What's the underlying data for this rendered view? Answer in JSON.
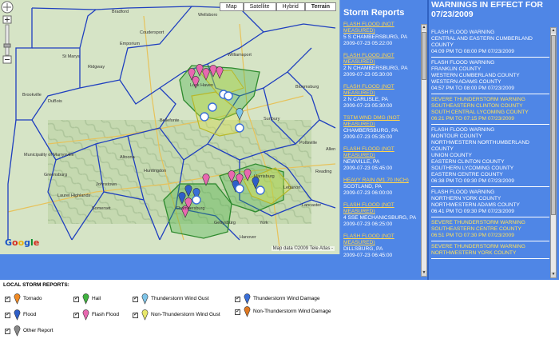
{
  "map": {
    "buttons": [
      "Map",
      "Satellite",
      "Hybrid",
      "Terrain"
    ],
    "active_button": "Terrain",
    "attribution": "Map data ©2009 Tele Atlas -",
    "logo": "Google",
    "place_labels": [
      "Bradford",
      "Wellsboro",
      "St Marys",
      "Ridgway",
      "DuBois",
      "Brookville",
      "Bellefonte",
      "Johnstown",
      "Somerset",
      "Altoona",
      "Huntingdon",
      "Chambersburg",
      "Gettysburg",
      "York",
      "Lancaster",
      "Reading",
      "Harrisburg",
      "Lebanon",
      "Sunbury",
      "Pottsville",
      "Bloomsburg",
      "Williamsport",
      "Allen",
      "Municipality of Murrysville",
      "Greensburg",
      "Laurel Highlands",
      "Hanover",
      "Coudersport",
      "Emporium",
      "Lock Haven"
    ]
  },
  "reports": {
    "title": "Storm Reports",
    "items": [
      {
        "type": "FLASH FLOOD (NOT MEASURED)",
        "location": "5 S CHAMBERSBURG, PA",
        "time": "2009-07-23 05:22:00"
      },
      {
        "type": "FLASH FLOOD (NOT MEASURED)",
        "location": "2 N CHAMBERSBURG, PA",
        "time": "2009-07-23 05:30:00"
      },
      {
        "type": "FLASH FLOOD (NOT MEASURED)",
        "location": "2 N CARLISLE, PA",
        "time": "2009-07-23 05:30:00"
      },
      {
        "type": "TSTM WND DMG (NOT MEASURED)",
        "location": "CHAMBERSBURG, PA",
        "time": "2009-07-23 05:35:00"
      },
      {
        "type": "FLASH FLOOD (NOT MEASURED)",
        "location": "NEWVILLE, PA",
        "time": "2009-07-23 05:45:00"
      },
      {
        "type": "HEAVY RAIN (M1.70 INCH)",
        "location": "SCOTLAND, PA",
        "time": "2009-07-23 06:00:00"
      },
      {
        "type": "FLASH FLOOD (NOT MEASURED)",
        "location": "4 SSE MECHANICSBURG, PA",
        "time": "2009-07-23 06:25:00"
      },
      {
        "type": "FLASH FLOOD (NOT MEASURED)",
        "location": "DILLSBURG, PA",
        "time": "2009-07-23 06:45:00"
      }
    ]
  },
  "warnings": {
    "title": "WARNINGS IN EFFECT FOR 07/23/2009",
    "items": [
      {
        "color": "white",
        "lines": [
          "FLASH FLOOD WARNING",
          "CENTRAL AND EASTERN CUMBERLAND COUNTY",
          "04:09 PM TO 08:00 PM 07/23/2009"
        ]
      },
      {
        "color": "white",
        "lines": [
          "FLASH FLOOD WARNING",
          "FRANKLIN COUNTY",
          "WESTERN CUMBERLAND COUNTY",
          "WESTERN ADAMS COUNTY",
          "04:57 PM TO 08:00 PM 07/23/2009"
        ]
      },
      {
        "color": "yellow",
        "lines": [
          "SEVERE THUNDERSTORM WARNING",
          "SOUTHEASTERN CLINTON COUNTY",
          "SOUTH CENTRAL LYCOMING COUNTY",
          "06:21 PM TO 07:15 PM 07/23/2009"
        ]
      },
      {
        "color": "white",
        "lines": [
          "FLASH FLOOD WARNING",
          "MONTOUR COUNTY",
          "NORTHWESTERN NORTHUMBERLAND COUNTY",
          "UNION COUNTY",
          "EASTERN CLINTON COUNTY",
          "SOUTHERN LYCOMING COUNTY",
          "EASTERN CENTRE COUNTY",
          "06:38 PM TO 09:30 PM 07/23/2009"
        ]
      },
      {
        "color": "white",
        "lines": [
          "FLASH FLOOD WARNING",
          "NORTHERN YORK COUNTY",
          "NORTHWESTERN ADAMS COUNTY",
          "06:41 PM TO 09:30 PM 07/23/2009"
        ]
      },
      {
        "color": "yellow",
        "lines": [
          "SEVERE THUNDERSTORM WARNING",
          "SOUTHEASTERN CENTRE COUNTY",
          "06:51 PM TO 07:30 PM 07/23/2009"
        ]
      },
      {
        "color": "yellow",
        "lines": [
          "SEVERE THUNDERSTORM WARNING",
          "NORTHWESTERN YORK COUNTY"
        ]
      }
    ]
  },
  "legend": {
    "title": "LOCAL STORM REPORTS:",
    "items": [
      {
        "label": "Tornado",
        "color": "#f08a24",
        "icon": "pin-icon"
      },
      {
        "label": "Hail",
        "color": "#3fb23f",
        "icon": "pin-icon"
      },
      {
        "label": "Thunderstorm Wind Gust",
        "color": "#7ec4e8",
        "icon": "pin-icon"
      },
      {
        "label": "Thunderstorm Wind Damage",
        "color": "#3a6fd8",
        "icon": "pin-icon"
      },
      {
        "label": "Flood",
        "color": "#2f5fc8",
        "icon": "pin-icon"
      },
      {
        "label": "Flash Flood",
        "color": "#e868b0",
        "icon": "pin-icon"
      },
      {
        "label": "Non-Thunderstorm Wind Gust",
        "color": "#e8e86a",
        "icon": "pin-icon"
      },
      {
        "label": "Non-Thunderstorm Wind Damage",
        "color": "#e07820",
        "icon": "pin-icon"
      },
      {
        "label": "Other Report",
        "color": "#888888",
        "icon": "pin-icon"
      }
    ]
  },
  "colors": {
    "panel_blue": "#4f86e6",
    "link_yellow": "#ffd64d",
    "county_line": "#1f3fbf",
    "flood_polygon": "#3fae3f",
    "tstorm_polygon": "#e6e64a"
  }
}
